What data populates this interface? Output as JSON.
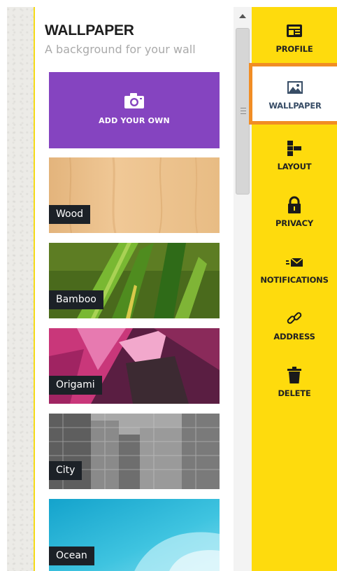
{
  "panel": {
    "title": "WALLPAPER",
    "subtitle": "A background for your wall",
    "add_label": "ADD YOUR OWN",
    "tiles": [
      {
        "label": "Wood"
      },
      {
        "label": "Bamboo"
      },
      {
        "label": "Origami"
      },
      {
        "label": "City"
      },
      {
        "label": "Ocean"
      }
    ]
  },
  "sidebar": {
    "items": [
      {
        "label": "PROFILE",
        "icon": "profile-card-icon"
      },
      {
        "label": "WALLPAPER",
        "icon": "image-icon",
        "active": true
      },
      {
        "label": "LAYOUT",
        "icon": "layout-icon"
      },
      {
        "label": "PRIVACY",
        "icon": "lock-icon"
      },
      {
        "label": "NOTIFICATIONS",
        "icon": "envelope-icon"
      },
      {
        "label": "ADDRESS",
        "icon": "link-icon"
      },
      {
        "label": "DELETE",
        "icon": "trash-icon"
      }
    ]
  },
  "colors": {
    "sidebar_bg": "#fedb0d",
    "active_border": "#f18d24",
    "add_button_bg": "#8544c0",
    "tag_bg": "#1c2127"
  }
}
